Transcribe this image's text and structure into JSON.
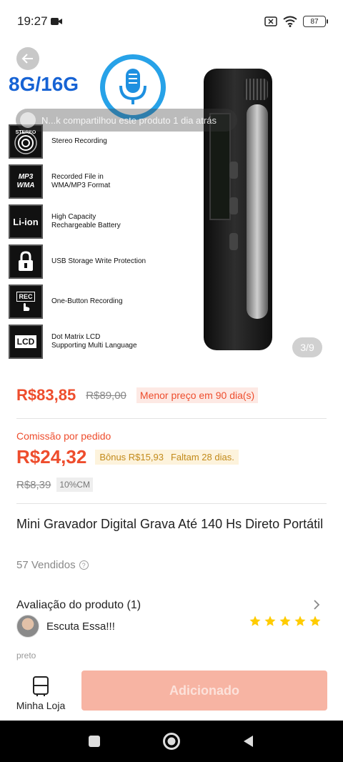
{
  "status_bar": {
    "time": "19:27",
    "battery": "87"
  },
  "hero": {
    "brand_text": "8G/16G",
    "share_toast": "N...k compartilhou este produto 1 dia atrás",
    "page_indicator": "3/9",
    "features": [
      {
        "icon_text": "STEREO",
        "label": "Stereo Recording"
      },
      {
        "icon_text": "MP3 WMA",
        "label": "Recorded File in\nWMA/MP3 Format"
      },
      {
        "icon_text": "Li-ion",
        "label": "High Capacity\nRechargeable Battery"
      },
      {
        "icon_text": "",
        "label": "USB Storage Write Protection"
      },
      {
        "icon_text": "REC",
        "label": "One-Button Recording"
      },
      {
        "icon_text": "LCD",
        "label": "Dot Matrix LCD\nSupporting Multi Language"
      }
    ]
  },
  "price": {
    "current": "R$83,85",
    "original": "R$89,00",
    "badge": "Menor preço em 90 dia(s)"
  },
  "commission": {
    "label": "Comissão por pedido",
    "value": "R$24,32",
    "bonus": "Bônus R$15,93",
    "days_left": "Faltam 28 dias.",
    "old_value": "R$8,39",
    "rate_badge": "10%CM"
  },
  "product": {
    "title": "Mini Gravador Digital Grava Até 140 Hs Direto Portátil",
    "sold": "57 Vendidos"
  },
  "reviews": {
    "header": "Avaliação do produto (1)",
    "review_text": "Escuta Essa!!!",
    "variant": "preto",
    "stars": 5
  },
  "bottom_bar": {
    "store_label": "Minha Loja",
    "add_button": "Adicionado"
  },
  "colors": {
    "accent": "#ee4d2d",
    "badge_bg": "#fde9e4",
    "bonus_text": "#c28a1a",
    "star": "#ffcc00",
    "button_disabled": "#f7b4a3"
  }
}
